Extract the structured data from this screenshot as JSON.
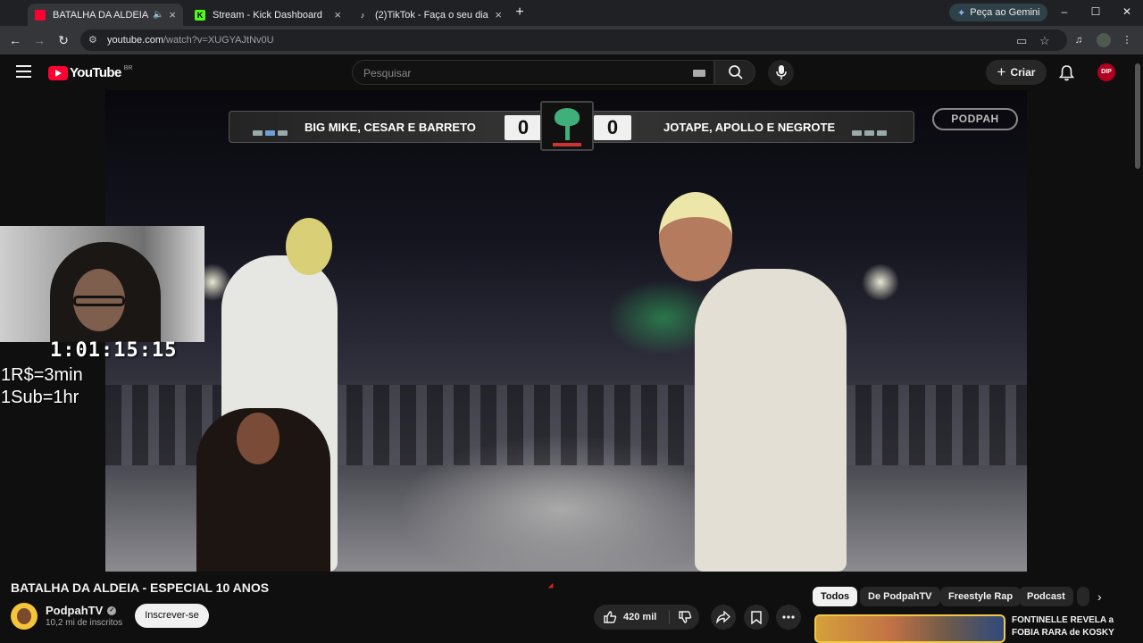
{
  "browser": {
    "tabs": [
      {
        "title": "BATALHA DA ALDEIA - ESPECIAL",
        "active": true,
        "favicon": "youtube-icon"
      },
      {
        "title": "Stream - Kick Dashboard",
        "active": false,
        "favicon": "kick-icon"
      },
      {
        "title": "(2)TikTok - Faça o seu dia",
        "active": false,
        "favicon": "tiktok-icon"
      }
    ],
    "gemini_label": "Peça ao Gemini",
    "url_host": "youtube.com",
    "url_path": "/watch?v=XUGYAJtNv0U"
  },
  "youtube": {
    "logo_text": "YouTube",
    "country_code": "BR",
    "search_placeholder": "Pesquisar",
    "create_label": "Criar",
    "account_badge": "DIP"
  },
  "video": {
    "team_left": "BIG MIKE, CESAR E BARRETO",
    "team_right": "JOTAPE, APOLLO E NEGROTE",
    "score_left": "0",
    "score_right": "0",
    "channel_watermark": "PODPAH"
  },
  "stream_overlay": {
    "timer": "1:01:15:15",
    "rate_line1": "1R$=3min",
    "rate_line2": "1Sub=1hr"
  },
  "watch": {
    "title": "BATALHA DA ALDEIA - ESPECIAL 10 ANOS",
    "channel_name": "PodpahTV",
    "subscribers": "10,2 mi de inscritos",
    "subscribe_label": "Inscrever-se",
    "likes": "420 mil"
  },
  "sidebar": {
    "chips": [
      "Todos",
      "De PodpahTV",
      "Freestyle Rap",
      "Podcast"
    ],
    "related_title": "FONTINELLE REVELA a FOBIA RARA de KOSKY"
  },
  "colors": {
    "youtube_red": "#ff0033",
    "background": "#0f0f0f",
    "chip_selected": "#f1f1f1"
  }
}
